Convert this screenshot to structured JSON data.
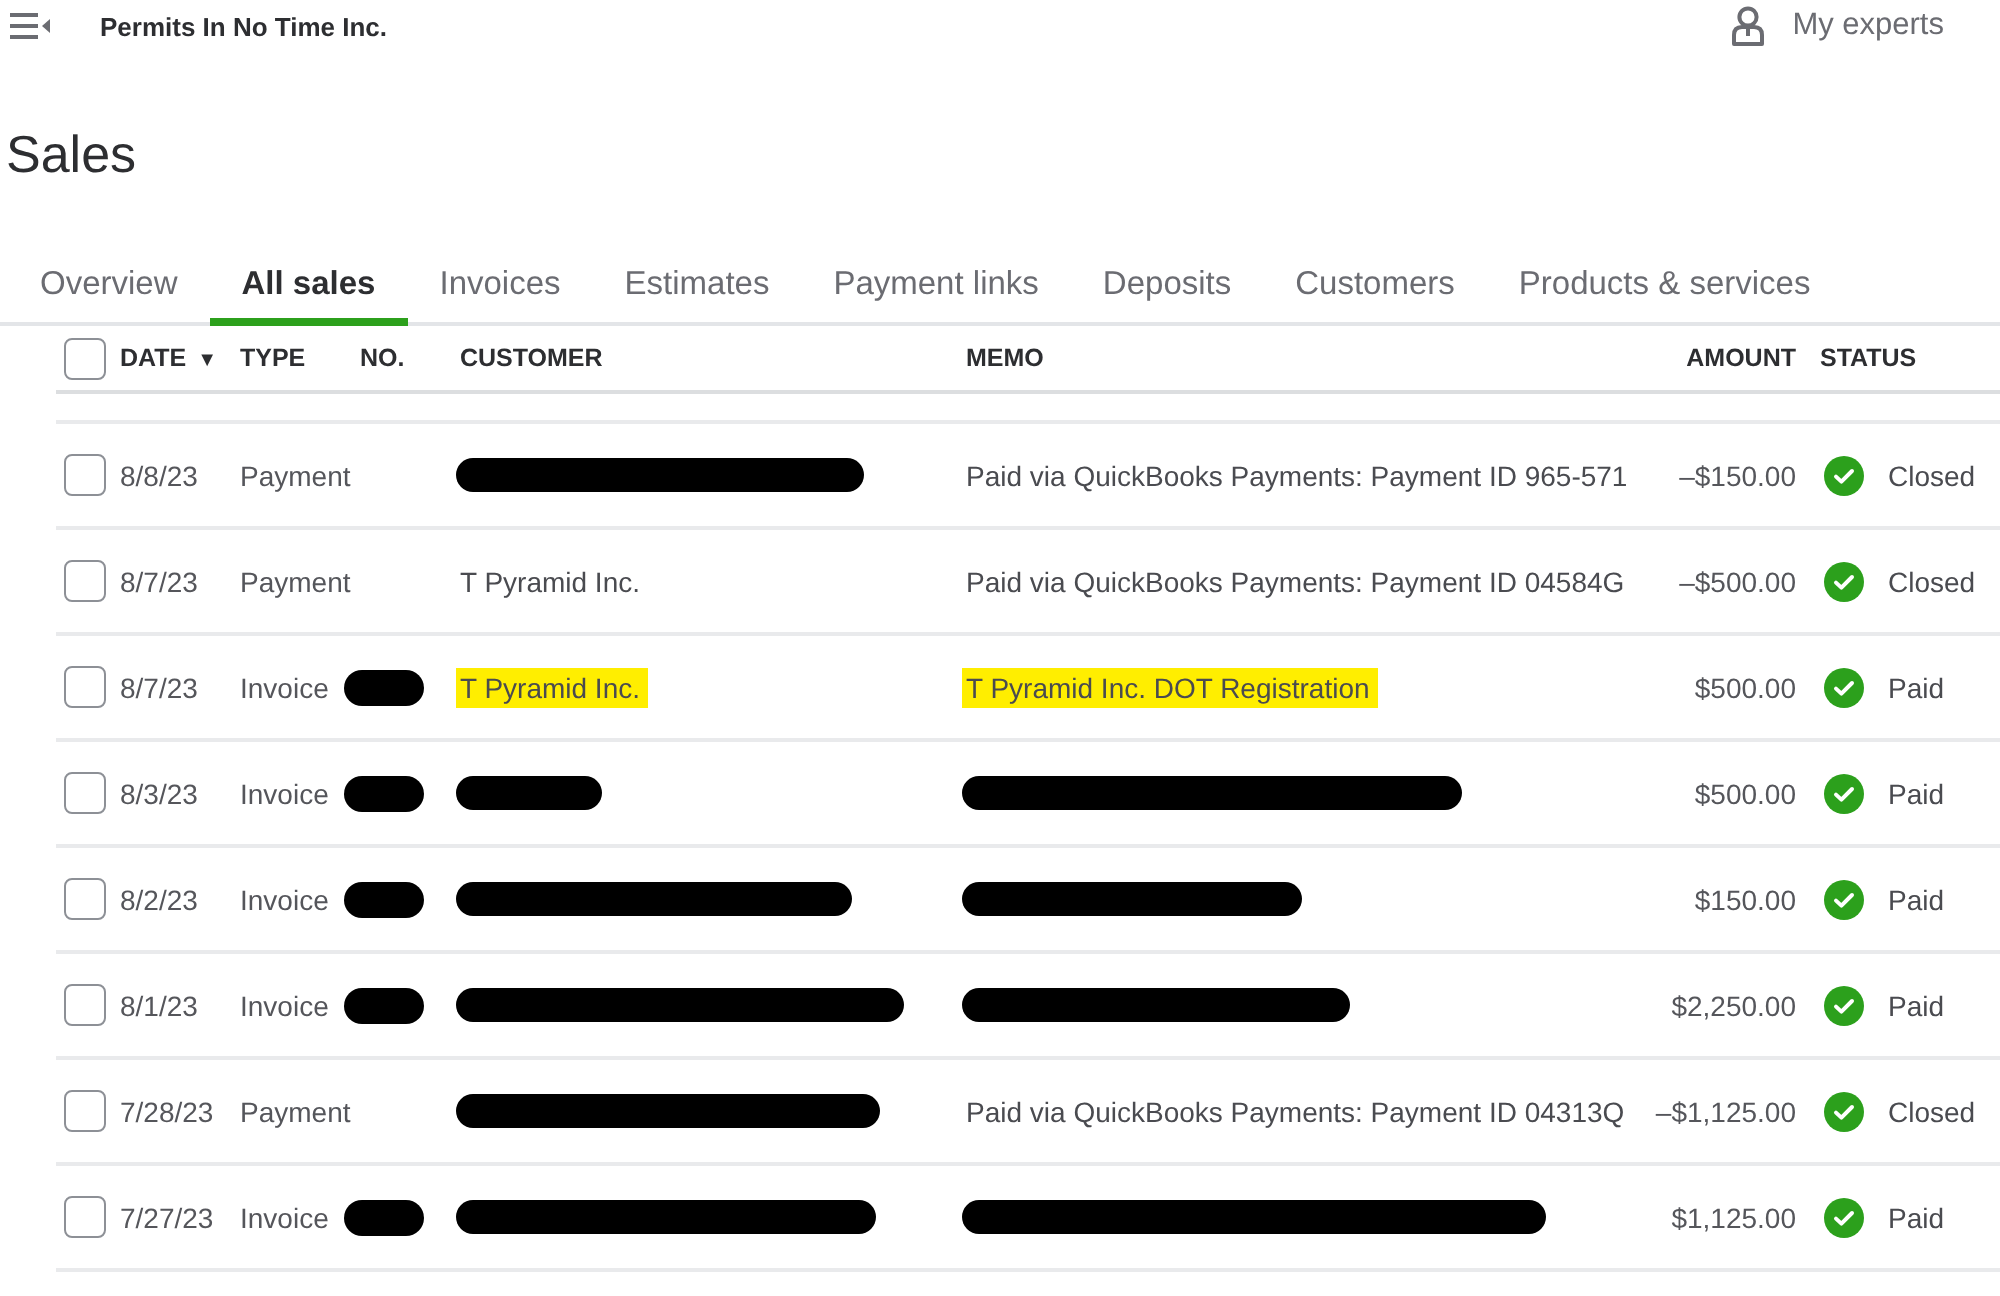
{
  "top_bar": {
    "company": "Permits In No Time Inc.",
    "experts_link": "My experts"
  },
  "page_title": "Sales",
  "tabs": [
    {
      "label": "Overview",
      "selected": false
    },
    {
      "label": "All sales",
      "selected": true
    },
    {
      "label": "Invoices",
      "selected": false
    },
    {
      "label": "Estimates",
      "selected": false
    },
    {
      "label": "Payment links",
      "selected": false
    },
    {
      "label": "Deposits",
      "selected": false
    },
    {
      "label": "Customers",
      "selected": false
    },
    {
      "label": "Products & services",
      "selected": false
    }
  ],
  "table": {
    "select_all": {
      "checked": false
    },
    "columns": [
      {
        "label": "DATE",
        "sort_mark": "▼"
      },
      {
        "label": "TYPE"
      },
      {
        "label": "NO."
      },
      {
        "label": "CUSTOMER"
      },
      {
        "label": "MEMO"
      },
      {
        "label": "AMOUNT"
      },
      {
        "label": "STATUS"
      }
    ],
    "rows": [
      {
        "checked": false,
        "date": "8/8/23",
        "type": "Payment",
        "customer": {
          "kind": "redacted"
        },
        "memo": {
          "kind": "text",
          "text": "Paid via QuickBooks Payments: Payment ID 965-571",
          "highlighted": false
        },
        "amount": "–$150.00",
        "status": "Closed"
      },
      {
        "checked": false,
        "date": "8/7/23",
        "type": "Payment",
        "customer": {
          "kind": "text",
          "text": "T Pyramid Inc.",
          "highlighted": false
        },
        "memo": {
          "kind": "text",
          "text": "Paid via QuickBooks Payments: Payment ID 04584G",
          "highlighted": false
        },
        "amount": "–$500.00",
        "status": "Closed"
      },
      {
        "checked": false,
        "date": "8/7/23",
        "type": "Invoice",
        "number": {
          "kind": "redacted"
        },
        "customer": {
          "kind": "text",
          "text": "T Pyramid Inc.",
          "highlighted": true
        },
        "memo": {
          "kind": "text",
          "text": "T Pyramid Inc. DOT Registration",
          "highlighted": true
        },
        "amount": "$500.00",
        "status": "Paid"
      },
      {
        "checked": false,
        "date": "8/3/23",
        "type": "Invoice",
        "number": {
          "kind": "redacted"
        },
        "customer": {
          "kind": "redacted"
        },
        "memo": {
          "kind": "redacted"
        },
        "amount": "$500.00",
        "status": "Paid"
      },
      {
        "checked": false,
        "date": "8/2/23",
        "type": "Invoice",
        "number": {
          "kind": "redacted"
        },
        "customer": {
          "kind": "redacted"
        },
        "memo": {
          "kind": "redacted"
        },
        "amount": "$150.00",
        "status": "Paid"
      },
      {
        "checked": false,
        "date": "8/1/23",
        "type": "Invoice",
        "number": {
          "kind": "redacted"
        },
        "customer": {
          "kind": "redacted"
        },
        "memo": {
          "kind": "redacted"
        },
        "amount": "$2,250.00",
        "status": "Paid"
      },
      {
        "checked": false,
        "date": "7/28/23",
        "type": "Payment",
        "customer": {
          "kind": "redacted"
        },
        "memo": {
          "kind": "text",
          "text": "Paid via QuickBooks Payments: Payment ID 04313Q",
          "highlighted": false
        },
        "amount": "–$1,125.00",
        "status": "Closed"
      },
      {
        "checked": false,
        "date": "7/27/23",
        "type": "Invoice",
        "number": {
          "kind": "redacted"
        },
        "customer": {
          "kind": "redacted"
        },
        "memo": {
          "kind": "redacted"
        },
        "amount": "$1,125.00",
        "status": "Paid"
      }
    ]
  }
}
